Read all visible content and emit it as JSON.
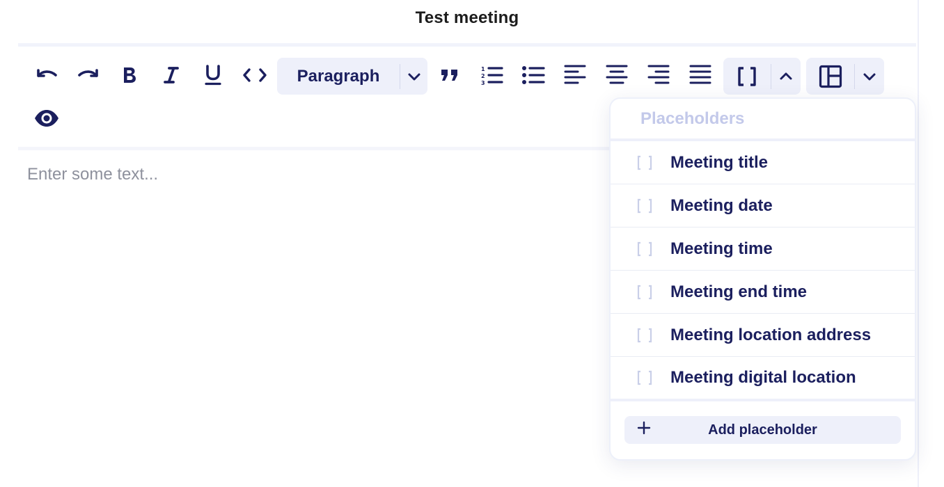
{
  "page": {
    "title": "Test meeting"
  },
  "toolbar": {
    "block_format": "Paragraph",
    "icons": {
      "undo": "undo-icon",
      "redo": "redo-icon",
      "bold": "bold-icon",
      "italic": "italic-icon",
      "underline": "underline-icon",
      "code": "code-icon",
      "quote": "quote-icon",
      "ordered_list": "ordered-list-icon",
      "bullet_list": "bullet-list-icon",
      "align_left": "align-left-icon",
      "align_center": "align-center-icon",
      "align_right": "align-right-icon",
      "align_justify": "align-justify-icon",
      "placeholder": "brackets-icon",
      "layout": "layout-icon",
      "preview": "eye-icon"
    }
  },
  "editor": {
    "placeholder": "Enter some text..."
  },
  "placeholders_menu": {
    "header": "Placeholders",
    "items": [
      {
        "label": "Meeting title",
        "icon": "brackets-icon"
      },
      {
        "label": "Meeting date",
        "icon": "brackets-icon"
      },
      {
        "label": "Meeting time",
        "icon": "brackets-icon"
      },
      {
        "label": "Meeting end time",
        "icon": "brackets-icon"
      },
      {
        "label": "Meeting location address",
        "icon": "brackets-icon"
      },
      {
        "label": "Meeting digital location",
        "icon": "brackets-icon"
      }
    ],
    "add_label": "Add placeholder"
  },
  "colors": {
    "icon": "#1b1f5e",
    "button_bg": "#eef0fa",
    "header_muted": "#c3c9ea",
    "placeholder_text": "#8e919d"
  }
}
